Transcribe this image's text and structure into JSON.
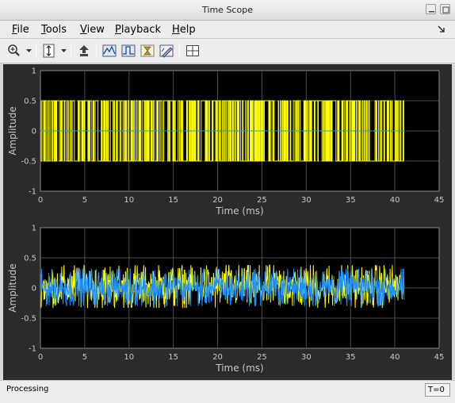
{
  "window": {
    "title": "Time Scope"
  },
  "menu": [
    {
      "key": "F",
      "rest": "ile"
    },
    {
      "key": "T",
      "rest": "ools"
    },
    {
      "key": "V",
      "rest": "iew"
    },
    {
      "key": "P",
      "rest": "layback"
    },
    {
      "key": "H",
      "rest": "elp"
    }
  ],
  "toolbar": {
    "buttons": [
      "zoom-in-icon",
      "scale-axes-icon",
      "step-back-icon",
      "signal-stats-icon",
      "bilevel-measurements-icon",
      "cursor-measurements-icon",
      "peak-finder-icon",
      "layout-grid-icon"
    ]
  },
  "plots": [
    {
      "ylabel": "Amplitude",
      "xlabel": "Time (ms)",
      "yticks": [
        "1",
        "0.5",
        "0",
        "-0.5",
        "-1"
      ],
      "xticks": [
        "0",
        "5",
        "10",
        "15",
        "20",
        "25",
        "30",
        "35",
        "40",
        "45"
      ],
      "chart_data": {
        "type": "line",
        "xlim": [
          0,
          45
        ],
        "ylim": [
          -1,
          1
        ],
        "grid": true,
        "series": [
          {
            "color": "#ffff00",
            "x_range_ms": [
              0,
              41
            ],
            "levels": [
              -0.5,
              0.5
            ],
            "shape": "random binary (bipolar) sequence"
          },
          {
            "color": "#2a9fd6",
            "x_range_ms": [
              0,
              41
            ],
            "value": 0
          }
        ]
      }
    },
    {
      "ylabel": "Amplitude",
      "xlabel": "Time (ms)",
      "yticks": [
        "1",
        "0.5",
        "0",
        "-0.5",
        "-1"
      ],
      "xticks": [
        "0",
        "5",
        "10",
        "15",
        "20",
        "25",
        "30",
        "35",
        "40",
        "45"
      ],
      "chart_data": {
        "type": "line",
        "xlim": [
          0,
          45
        ],
        "ylim": [
          -1,
          1
        ],
        "grid": true,
        "series": [
          {
            "color": "#ffff00",
            "x_range_ms": [
              0,
              41
            ],
            "amplitude_range": [
              -0.33,
              0.38
            ],
            "shape": "noise"
          },
          {
            "color": "#1e90ff",
            "x_range_ms": [
              0,
              41
            ],
            "amplitude_range": [
              -0.3,
              0.32
            ],
            "shape": "noise"
          }
        ]
      }
    }
  ],
  "status": {
    "text": "Processing",
    "time": "T=0"
  },
  "colors": {
    "plot_bg": "#000000",
    "figure_bg": "#2b2b2b",
    "grid": "#4d4d4d",
    "axis_text": "#c8c8c8"
  }
}
